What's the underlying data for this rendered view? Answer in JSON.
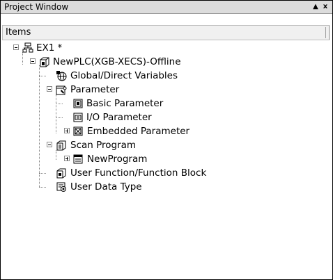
{
  "window": {
    "title": "Project Window",
    "pin_glyph": "▲",
    "close_glyph": "x"
  },
  "header": {
    "items_label": "Items"
  },
  "tree": {
    "root": {
      "label": "EX1",
      "badge": "*",
      "icon": "project-network-icon",
      "plc": {
        "label": "NewPLC(XGB-XECS)-Offline",
        "icon": "plc-cpu-icon",
        "children": [
          {
            "label": "Global/Direct Variables",
            "icon": "variables-globe-icon"
          },
          {
            "label": "Parameter",
            "icon": "parameter-folder-icon",
            "children": [
              {
                "label": "Basic Parameter",
                "icon": "basic-parameter-icon"
              },
              {
                "label": "I/O Parameter",
                "icon": "io-parameter-icon"
              },
              {
                "label": "Embedded Parameter",
                "icon": "embedded-parameter-icon"
              }
            ]
          },
          {
            "label": "Scan Program",
            "icon": "scan-program-icon",
            "children": [
              {
                "label": "NewProgram",
                "icon": "program-icon"
              }
            ]
          },
          {
            "label": "User Function/Function Block",
            "icon": "user-function-icon"
          },
          {
            "label": "User Data Type",
            "icon": "user-data-type-icon"
          }
        ]
      }
    }
  }
}
